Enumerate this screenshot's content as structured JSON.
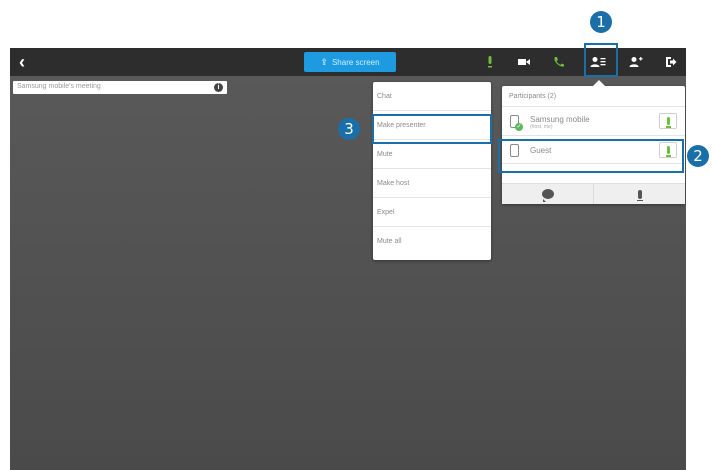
{
  "topbar": {
    "back_glyph": "‹",
    "share_icon": "⇪",
    "share_label": "Share screen",
    "icons": [
      "mic-icon",
      "video-icon",
      "phone-icon",
      "participants-icon",
      "add-person-icon",
      "exit-icon"
    ]
  },
  "meeting": {
    "title": "Samsung mobile's meeting",
    "info_glyph": "i"
  },
  "context_menu": {
    "items": [
      "Chat",
      "Make presenter",
      "Mute",
      "Make host",
      "Expel",
      "Mute all"
    ]
  },
  "participants": {
    "title": "Participants (2)",
    "rows": [
      {
        "name": "Samsung mobile",
        "sub": "(host, me)"
      },
      {
        "name": "Guest",
        "sub": ""
      }
    ]
  },
  "callouts": [
    "1",
    "2",
    "3"
  ],
  "colors": {
    "accent": "#1b6fa8",
    "share_button": "#1e9be0",
    "mic_active": "#6cbf3a",
    "topbar": "#2d2d2d"
  }
}
